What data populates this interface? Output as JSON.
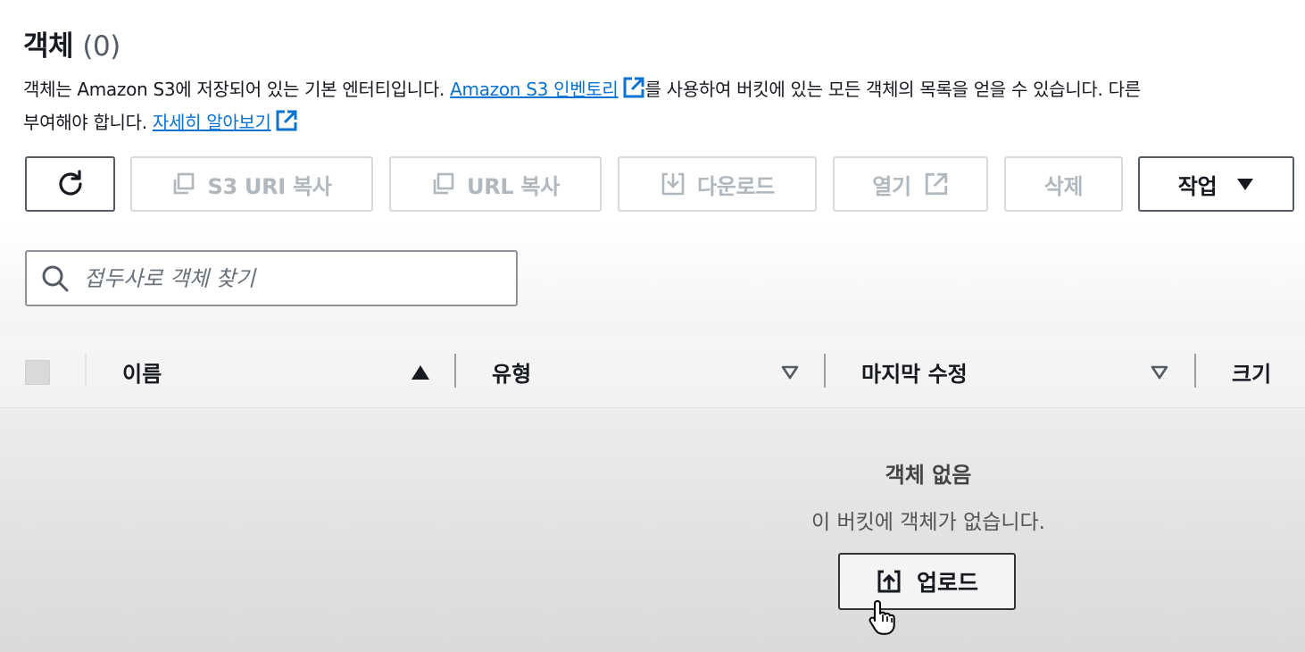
{
  "header": {
    "title": "객체",
    "count": "(0)",
    "desc_part1": "객체는 Amazon S3에 저장되어 있는 기본 엔터티입니다. ",
    "inventory_link": "Amazon S3 인벤토리",
    "desc_part2": "를 사용하여 버킷에 있는 모든 객체의 목록을 얻을 수 있습니다. 다른",
    "desc_line2": "부여해야 합니다. ",
    "learn_more_link": "자세히 알아보기"
  },
  "toolbar": {
    "refresh_icon": "refresh-icon",
    "copy_s3_uri_label": "S3 URI 복사",
    "copy_url_label": "URL 복사",
    "download_label": "다운로드",
    "open_label": "열기",
    "delete_label": "삭제",
    "actions_label": "작업"
  },
  "search": {
    "placeholder": "접두사로 객체 찾기",
    "value": ""
  },
  "table": {
    "columns": [
      "이름",
      "유형",
      "마지막 수정",
      "크기"
    ]
  },
  "empty_state": {
    "title": "객체 없음",
    "subtitle": "이 버킷에 객체가 없습니다.",
    "upload_label": "업로드"
  },
  "colors": {
    "link": "#0972d3",
    "text": "#16191f",
    "disabled": "#b0b7bd"
  }
}
